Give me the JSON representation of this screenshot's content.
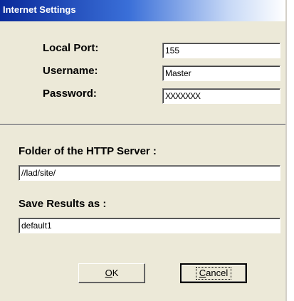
{
  "window": {
    "title": "Internet Settings"
  },
  "fields": {
    "local_port": {
      "label": "Local Port:",
      "value": "155"
    },
    "username": {
      "label": "Username:",
      "value": "Master"
    },
    "password": {
      "label": "Password:",
      "value": "XXXXXXX"
    },
    "http_folder": {
      "label": "Folder of the HTTP Server :",
      "value": "//lad/site/"
    },
    "save_results": {
      "label": "Save Results as :",
      "value": "default1"
    }
  },
  "buttons": {
    "ok": {
      "mnemonic": "O",
      "rest": "K"
    },
    "cancel": {
      "mnemonic": "C",
      "rest": "ancel"
    }
  },
  "colors": {
    "dialog_bg": "#ece9d8",
    "title_start": "#0a2a9a",
    "title_end": "#ffffff"
  }
}
